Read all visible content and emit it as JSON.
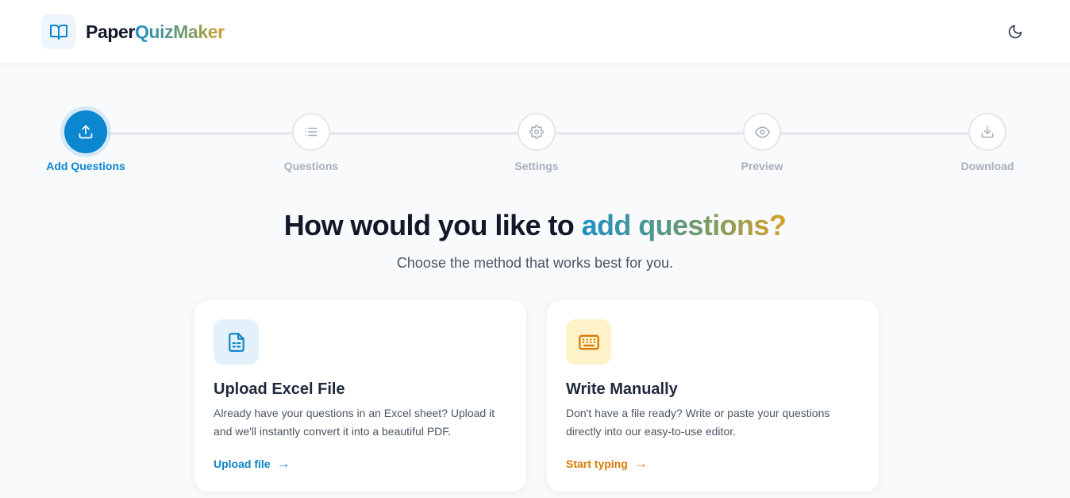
{
  "header": {
    "brand_part1": "Paper",
    "brand_part2": "QuizMaker",
    "logo_icon": "book-open-icon",
    "theme_toggle_icon": "moon-icon"
  },
  "stepper": {
    "steps": [
      {
        "label": "Add Questions",
        "icon": "upload-icon",
        "active": true
      },
      {
        "label": "Questions",
        "icon": "list-icon",
        "active": false
      },
      {
        "label": "Settings",
        "icon": "gear-icon",
        "active": false
      },
      {
        "label": "Preview",
        "icon": "eye-icon",
        "active": false
      },
      {
        "label": "Download",
        "icon": "download-icon",
        "active": false
      }
    ]
  },
  "main": {
    "heading_prefix": "How would you like to ",
    "heading_accent": "add questions?",
    "subheading": "Choose the method that works best for you."
  },
  "cards": [
    {
      "title": "Upload Excel File",
      "description": "Already have your questions in an Excel sheet? Upload it and we'll instantly convert it into a beautiful PDF.",
      "link_label": "Upload file",
      "arrow": "→",
      "icon": "spreadsheet-file-icon",
      "accent_color": "#0b84c6",
      "icon_bg": "#e3f1fb"
    },
    {
      "title": "Write Manually",
      "description": "Don't have a file ready? Write or paste your questions directly into our easy-to-use editor.",
      "link_label": "Start typing",
      "arrow": "→",
      "icon": "keyboard-icon",
      "accent_color": "#d97a06",
      "icon_bg": "#fdf2c8"
    }
  ],
  "colors": {
    "primary": "#0b87d0",
    "inactive": "#a8b0bc",
    "background": "#f8fafc"
  }
}
